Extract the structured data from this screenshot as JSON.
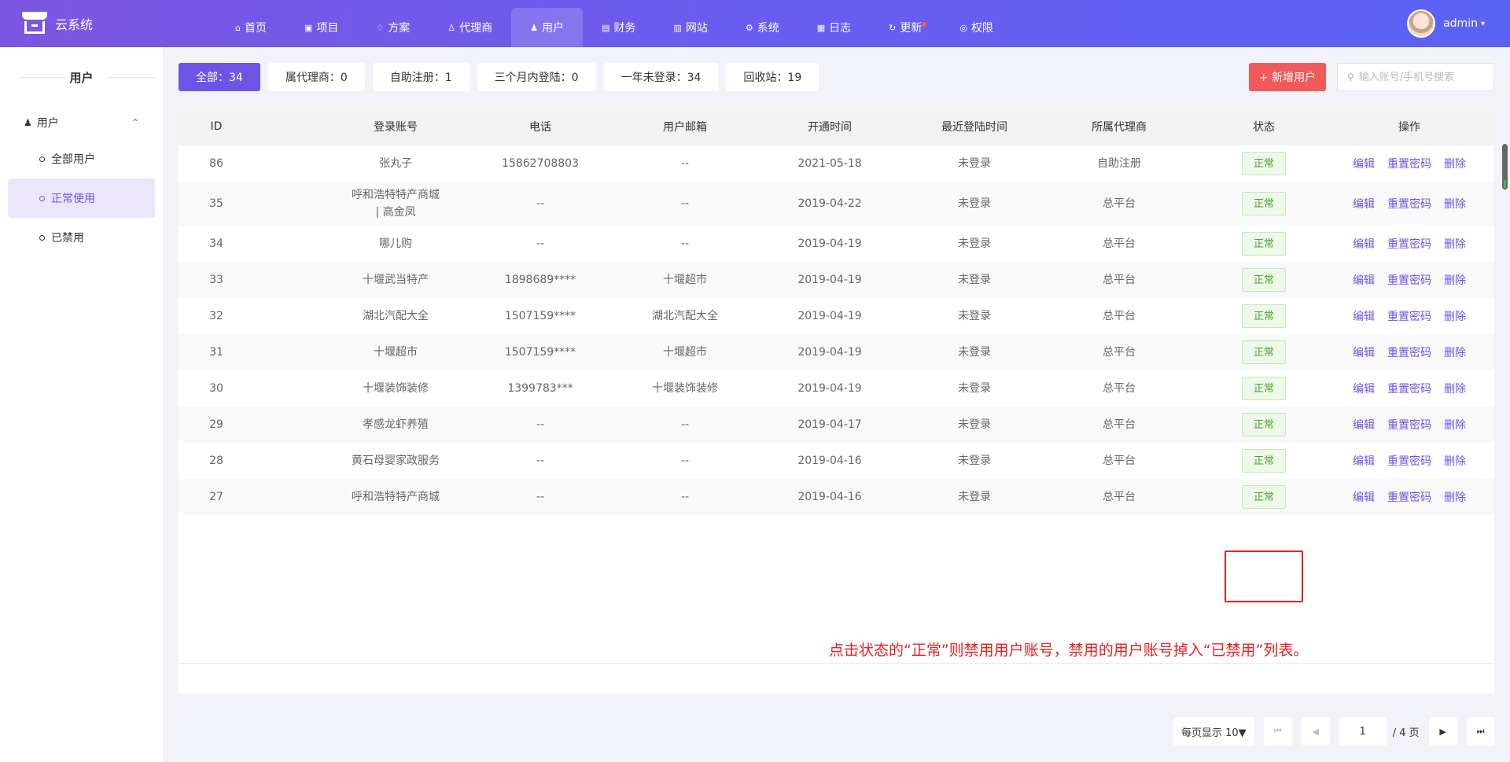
{
  "brand": {
    "name": "云系统",
    "icon": "store-icon"
  },
  "nav": {
    "items": [
      {
        "label": "首页",
        "icon": "home-icon",
        "symbol": "⌂"
      },
      {
        "label": "项目",
        "icon": "briefcase-icon",
        "symbol": "▣"
      },
      {
        "label": "方案",
        "icon": "diamond-icon",
        "symbol": "♢"
      },
      {
        "label": "代理商",
        "icon": "users-icon",
        "symbol": "♙"
      },
      {
        "label": "用户",
        "icon": "user-icon",
        "symbol": "♟",
        "active": true
      },
      {
        "label": "财务",
        "icon": "wallet-icon",
        "symbol": "▤"
      },
      {
        "label": "网站",
        "icon": "browser-icon",
        "symbol": "▥"
      },
      {
        "label": "系统",
        "icon": "gear-icon",
        "symbol": "⚙"
      },
      {
        "label": "日志",
        "icon": "log-icon",
        "symbol": "▦"
      },
      {
        "label": "更新",
        "icon": "refresh-icon",
        "symbol": "↻",
        "dot": true
      },
      {
        "label": "权限",
        "icon": "shield-check-icon",
        "symbol": "◎"
      }
    ]
  },
  "user": {
    "name": "admin"
  },
  "sidebar": {
    "title": "用户",
    "group": {
      "label": "用户"
    },
    "items": [
      {
        "label": "全部用户"
      },
      {
        "label": "正常使用"
      },
      {
        "label": "已禁用"
      }
    ]
  },
  "filters": [
    {
      "label": "全部：34"
    },
    {
      "label": "属代理商：0"
    },
    {
      "label": "自助注册：1"
    },
    {
      "label": "三个月内登陆：0"
    },
    {
      "label": "一年未登录：34"
    },
    {
      "label": "回收站：19"
    }
  ],
  "toolbar": {
    "add_label": "+ 新增用户",
    "search_placeholder": "输入账号/手机号搜索"
  },
  "table": {
    "headers": {
      "id": "ID",
      "account": "登录账号",
      "phone": "电话",
      "email": "用户邮箱",
      "open": "开通时间",
      "last": "最近登陆时间",
      "agent": "所属代理商",
      "status": "状态",
      "ops": "操作"
    },
    "ops": {
      "edit": "编辑",
      "reset": "重置密码",
      "delete": "删除"
    },
    "rows": [
      {
        "id": "86",
        "account": "张丸子",
        "phone": "15862708803",
        "email": "--",
        "open": "2021-05-18",
        "last": "未登录",
        "agent": "自助注册",
        "status": "正常"
      },
      {
        "id": "35",
        "account": "呼和浩特特产商城 | 高金凤",
        "phone": "--",
        "email": "--",
        "open": "2019-04-22",
        "last": "未登录",
        "agent": "总平台",
        "status": "正常"
      },
      {
        "id": "34",
        "account": "哪儿购",
        "phone": "--",
        "email": "--",
        "open": "2019-04-19",
        "last": "未登录",
        "agent": "总平台",
        "status": "正常"
      },
      {
        "id": "33",
        "account": "十堰武当特产",
        "phone": "1898689****",
        "email": "十堰超市",
        "open": "2019-04-19",
        "last": "未登录",
        "agent": "总平台",
        "status": "正常"
      },
      {
        "id": "32",
        "account": "湖北汽配大全",
        "phone": "1507159****",
        "email": "湖北汽配大全",
        "open": "2019-04-19",
        "last": "未登录",
        "agent": "总平台",
        "status": "正常"
      },
      {
        "id": "31",
        "account": "十堰超市",
        "phone": "1507159****",
        "email": "十堰超市",
        "open": "2019-04-19",
        "last": "未登录",
        "agent": "总平台",
        "status": "正常"
      },
      {
        "id": "30",
        "account": "十堰装饰装修",
        "phone": "1399783***",
        "email": "十堰装饰装修",
        "open": "2019-04-19",
        "last": "未登录",
        "agent": "总平台",
        "status": "正常"
      },
      {
        "id": "29",
        "account": "孝感龙虾养殖",
        "phone": "--",
        "email": "--",
        "open": "2019-04-17",
        "last": "未登录",
        "agent": "总平台",
        "status": "正常"
      },
      {
        "id": "28",
        "account": "黄石母婴家政服务",
        "phone": "--",
        "email": "--",
        "open": "2019-04-16",
        "last": "未登录",
        "agent": "总平台",
        "status": "正常"
      },
      {
        "id": "27",
        "account": "呼和浩特特产商城",
        "phone": "--",
        "email": "--",
        "open": "2019-04-16",
        "last": "未登录",
        "agent": "总平台",
        "status": "正常"
      }
    ]
  },
  "annotation": "点击状态的“正常”则禁用用户账号，禁用的用户账号掉入“已禁用”列表。",
  "pagination": {
    "page_size_label": "每页显示 10▼",
    "current": "1",
    "total_label": "/ 4 页"
  },
  "colors": {
    "accent": "#6e54e5",
    "danger": "#f25a5a",
    "success": "#49a628",
    "annotation": "#e82121"
  }
}
